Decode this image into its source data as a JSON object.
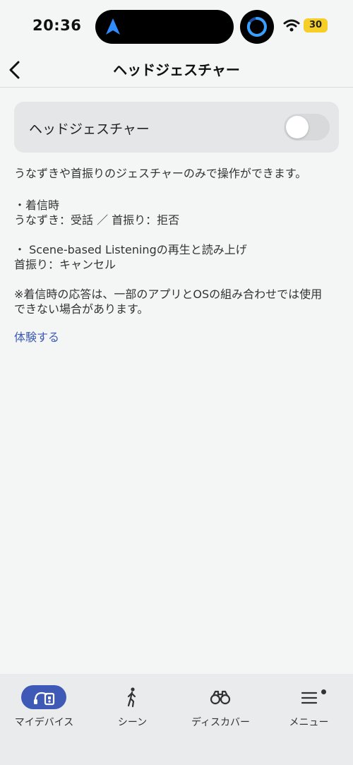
{
  "status_bar": {
    "time": "20:36",
    "battery": "30",
    "battery_color": "#f5cf25"
  },
  "header": {
    "title": "ヘッドジェスチャー",
    "back_icon": "chevron-left-icon"
  },
  "toggle": {
    "label": "ヘッドジェスチャー",
    "state": "off"
  },
  "content": {
    "lines": [
      "うなずきや首振りのジェスチャーのみで操作ができます。",
      "・着信時",
      "うなずき：受話 ／ 首振り：拒否",
      "・ Scene-based Listeningの再生と読み上げ",
      "首振り：キャンセル",
      "※着信時の応答は、一部のアプリとOSの組み合わせでは使用",
      "できない場合があります。"
    ],
    "link": "体験する",
    "link_color": "#3d5ab4"
  },
  "tabbar": {
    "accent": "#3f5ab6",
    "items": [
      {
        "label": "マイデバイス",
        "icon": "headphones-device-icon",
        "active": true
      },
      {
        "label": "シーン",
        "icon": "walking-person-icon",
        "active": false
      },
      {
        "label": "ディスカバー",
        "icon": "binoculars-icon",
        "active": false
      },
      {
        "label": "メニュー",
        "icon": "menu-icon",
        "active": false,
        "badge": true
      }
    ]
  }
}
